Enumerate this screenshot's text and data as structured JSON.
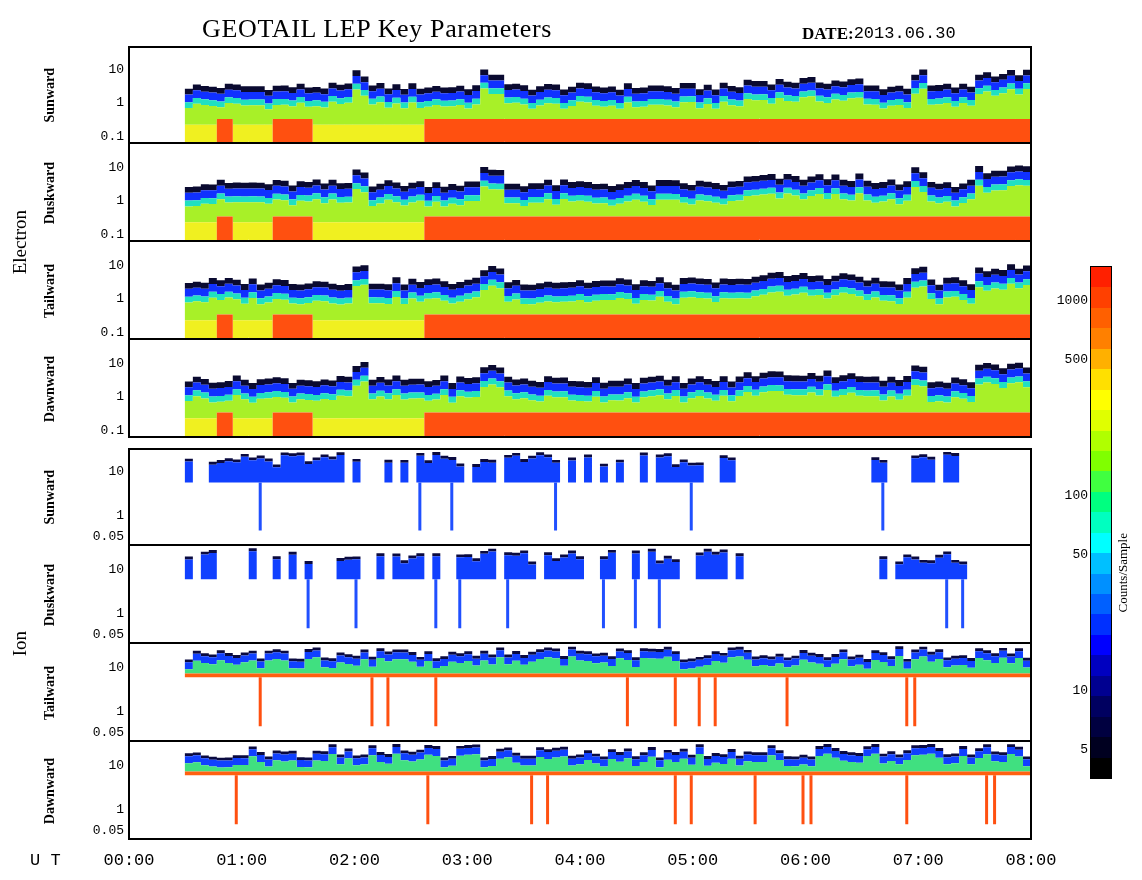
{
  "title": "GEOTAIL LEP Key Parameters",
  "date_label": "DATE:",
  "date_value": "2013.06.30",
  "groups": [
    {
      "label": "Electron",
      "kind": "electron",
      "panels": [
        {
          "label": "Sunward",
          "yticks": [
            "10",
            "1",
            "0.1"
          ]
        },
        {
          "label": "Duskward",
          "yticks": [
            "10",
            "1",
            "0.1"
          ]
        },
        {
          "label": "Tailward",
          "yticks": [
            "10",
            "1",
            "0.1"
          ]
        },
        {
          "label": "Dawnward",
          "yticks": [
            "10",
            "1",
            "0.1"
          ]
        }
      ]
    },
    {
      "label": "Ion",
      "kind": "ion",
      "panels": [
        {
          "label": "Sunward",
          "yticks": [
            "10",
            "1",
            "0.05"
          ]
        },
        {
          "label": "Duskward",
          "yticks": [
            "10",
            "1",
            "0.05"
          ]
        },
        {
          "label": "Tailward",
          "yticks": [
            "10",
            "1",
            "0.05"
          ]
        },
        {
          "label": "Dawnward",
          "yticks": [
            "10",
            "1",
            "0.05"
          ]
        }
      ]
    }
  ],
  "colorbar": {
    "label": "Counts/Sample",
    "ticks": [
      "1000",
      "500",
      "100",
      "50",
      "10",
      "5"
    ]
  },
  "x_axis": {
    "label": "U T",
    "ticks": [
      "00:00",
      "01:00",
      "02:00",
      "03:00",
      "04:00",
      "05:00",
      "06:00",
      "07:00",
      "08:00"
    ]
  }
}
